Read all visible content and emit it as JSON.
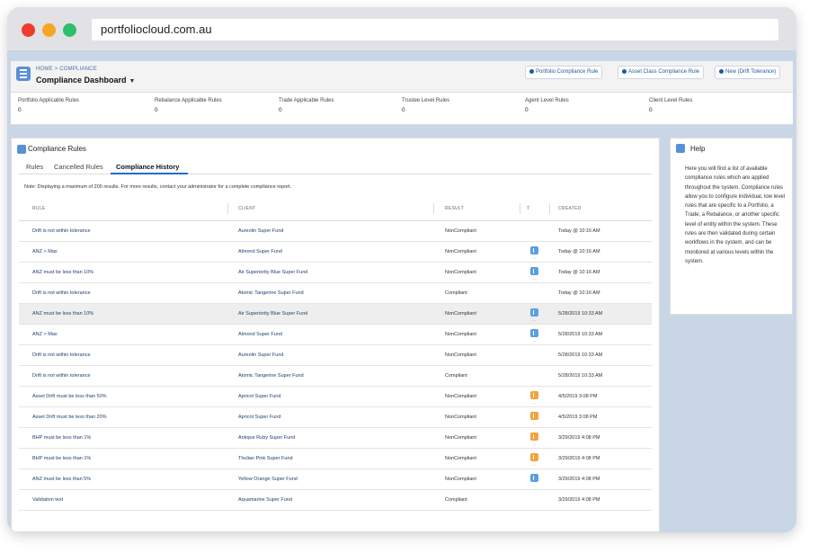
{
  "browser": {
    "url": "portfoliocloud.com.au"
  },
  "header": {
    "breadcrumb": "HOME > COMPLIANCE",
    "title": "Compliance Dashboard",
    "buttons": [
      "Portfolio Compliance Rule",
      "Asset Class Compliance Rule",
      "New (Drift Tolerance)"
    ]
  },
  "stats": [
    {
      "label": "Portfolio Applicable Rules",
      "value": "0"
    },
    {
      "label": "Rebalance Applicable Rules",
      "value": "0"
    },
    {
      "label": "Trade Applicable Rules",
      "value": "0"
    },
    {
      "label": "Trustee Level Rules",
      "value": "0"
    },
    {
      "label": "Agent Level Rules",
      "value": "0"
    },
    {
      "label": "Client Level Rules",
      "value": "0"
    }
  ],
  "rules_card": {
    "title": "Compliance Rules",
    "tabs": [
      "Rules",
      "Cancelled Rules",
      "Compliance History"
    ],
    "active_tab": "Compliance History",
    "note": "Note: Displaying a maximum of 200 results. For more results, contact your administrator for a complete compliance report.",
    "columns": [
      "RULE",
      "CLIENT",
      "RESULT",
      "T",
      "CREATED"
    ],
    "rows": [
      {
        "rule": "Drift is not within tolerance",
        "client": "Aureolin Super Fund",
        "result": "NonCompliant",
        "flag": "",
        "created": "Today @ 10:16 AM"
      },
      {
        "rule": "ANZ > Max",
        "client": "Almond Super Fund",
        "result": "NonCompliant",
        "flag": "blue",
        "created": "Today @ 10:16 AM"
      },
      {
        "rule": "ANZ must be less than 10%",
        "client": "Air Superiority Blue Super Fund",
        "result": "NonCompliant",
        "flag": "blue",
        "created": "Today @ 10:16 AM"
      },
      {
        "rule": "Drift is not within tolerance",
        "client": "Atomic Tangerine Super Fund",
        "result": "Compliant",
        "flag": "",
        "created": "Today @ 10:16 AM"
      },
      {
        "rule": "ANZ must be less than 10%",
        "client": "Air Superiority Blue Super Fund",
        "result": "NonCompliant",
        "flag": "blue",
        "created": "5/28/2019 10:33 AM"
      },
      {
        "rule": "ANZ > Max",
        "client": "Almond Super Fund",
        "result": "NonCompliant",
        "flag": "blue",
        "created": "5/28/2019 10:33 AM"
      },
      {
        "rule": "Drift is not within tolerance",
        "client": "Aureolin Super Fund",
        "result": "NonCompliant",
        "flag": "",
        "created": "5/28/2019 10:33 AM"
      },
      {
        "rule": "Drift is not within tolerance",
        "client": "Atomic Tangerine Super Fund",
        "result": "Compliant",
        "flag": "",
        "created": "5/28/2019 10:33 AM"
      },
      {
        "rule": "Asset Drift must be less than 50%",
        "client": "Apricot Super Fund",
        "result": "NonCompliant",
        "flag": "orange",
        "created": "4/5/2019 3:08 PM"
      },
      {
        "rule": "Asset Drift must be less than 20%",
        "client": "Apricot Super Fund",
        "result": "NonCompliant",
        "flag": "orange",
        "created": "4/5/2019 3:08 PM"
      },
      {
        "rule": "BHP must be less than 1%",
        "client": "Antique Ruby Super Fund",
        "result": "NonCompliant",
        "flag": "orange",
        "created": "3/29/2019 4:08 PM"
      },
      {
        "rule": "BHP must be less than 1%",
        "client": "Thulian Pink Super Fund",
        "result": "NonCompliant",
        "flag": "orange",
        "created": "3/29/2019 4:08 PM"
      },
      {
        "rule": "ANZ must be less than 5%",
        "client": "Yellow Orange Super Fund",
        "result": "NonCompliant",
        "flag": "blue",
        "created": "3/29/2019 4:08 PM"
      },
      {
        "rule": "Validation text",
        "client": "Aquamarine Super Fund",
        "result": "Compliant",
        "flag": "",
        "created": "3/29/2019 4:08 PM"
      }
    ]
  },
  "help": {
    "title": "Help",
    "text": "Here you will find a list of available compliance rules which are applied throughout the system. Compliance rules allow you to configure individual, low level rules that are specific to a Portfolio, a Trade, a Rebalance, or another specific level of entity within the system. These rules are then validated during certain workflows in the system, and can be monitored at various levels within the system."
  }
}
